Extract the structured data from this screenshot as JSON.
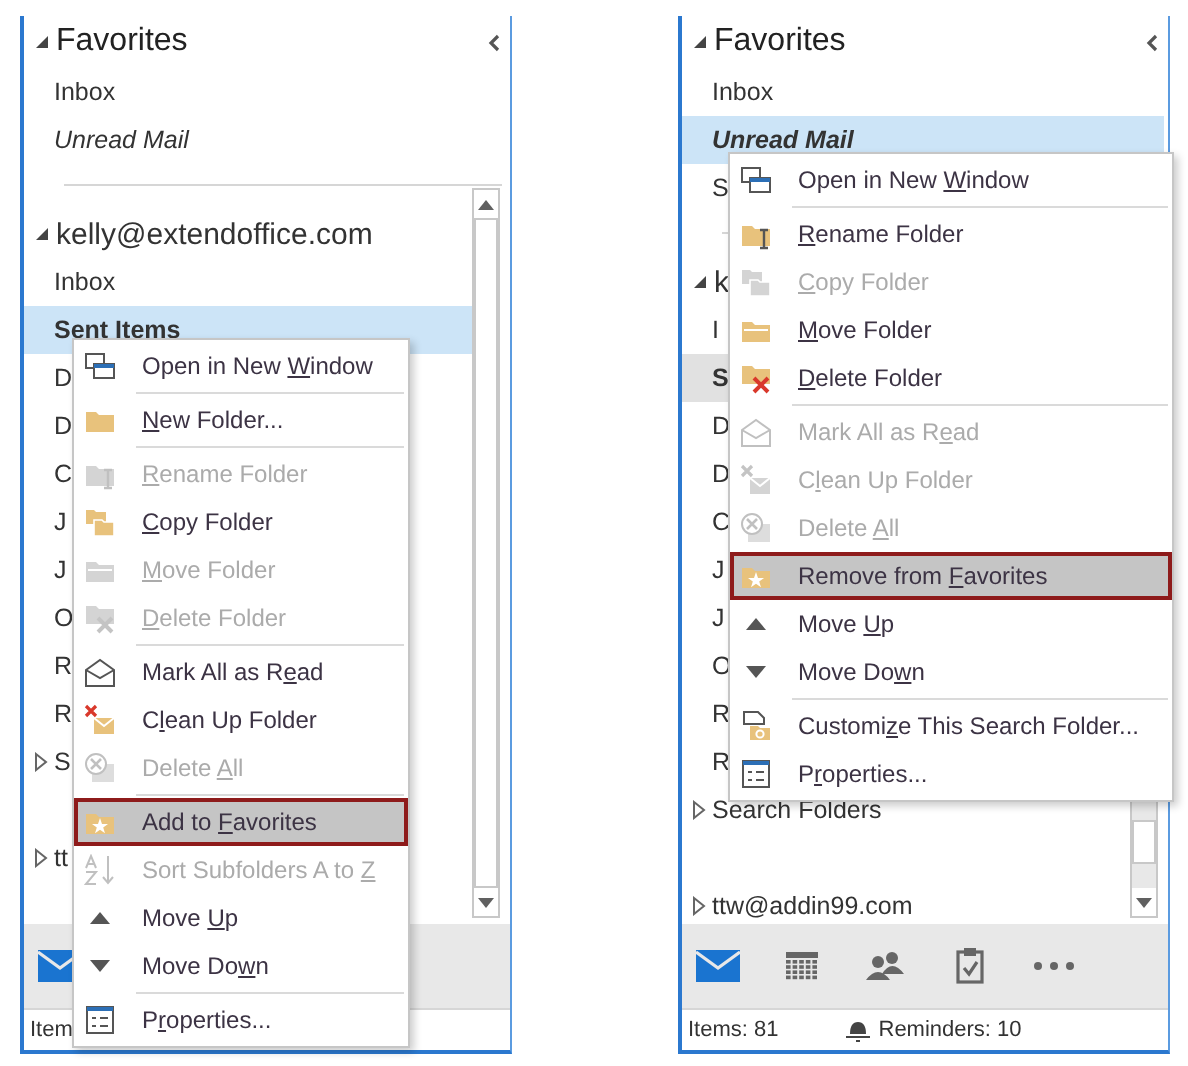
{
  "panes": [
    {
      "favorites": {
        "title": "Favorites",
        "expanded": true,
        "items": [
          {
            "label": "Inbox",
            "italic": false,
            "selected": false,
            "focused": false
          },
          {
            "label": "Unread Mail",
            "italic": true,
            "selected": false,
            "focused": false
          }
        ]
      },
      "account": {
        "title": "kelly@extendoffice.com",
        "expanded": true,
        "folders": [
          {
            "label": "Inbox",
            "selected": false,
            "focused": false
          },
          {
            "label": "Sent Items",
            "selected": true,
            "focused": true
          },
          {
            "label": "D",
            "selected": false,
            "focused": false
          },
          {
            "label": "D",
            "selected": false,
            "focused": false
          },
          {
            "label": "C",
            "selected": false,
            "focused": false
          },
          {
            "label": "J",
            "selected": false,
            "focused": false
          },
          {
            "label": "J",
            "selected": false,
            "focused": false
          },
          {
            "label": "O",
            "selected": false,
            "focused": false
          },
          {
            "label": "R",
            "selected": false,
            "focused": false
          },
          {
            "label": "R",
            "selected": false,
            "focused": false
          }
        ]
      },
      "sections": [
        {
          "label": "S",
          "expanded": false
        },
        {
          "label": "tt",
          "expanded": false
        }
      ],
      "nav": [
        {
          "kind": "mail",
          "selected": true
        }
      ],
      "status": {
        "items": "Item"
      },
      "menu": {
        "entries": [
          {
            "kind": "window",
            "label": {
              "before": "Open in New ",
              "key": "W",
              "after": "indow"
            },
            "disabled": false,
            "highlighted": false
          },
          {
            "kind": "separator"
          },
          {
            "kind": "folder",
            "label": {
              "key": "N",
              "after": "ew Folder..."
            },
            "disabled": false,
            "highlighted": false
          },
          {
            "kind": "separator"
          },
          {
            "kind": "rename",
            "label": {
              "key": "R",
              "after": "ename Folder"
            },
            "disabled": true,
            "highlighted": false
          },
          {
            "kind": "copy",
            "label": {
              "key": "C",
              "after": "opy Folder"
            },
            "disabled": false,
            "highlighted": false
          },
          {
            "kind": "move",
            "label": {
              "key": "M",
              "after": "ove Folder"
            },
            "disabled": true,
            "highlighted": false
          },
          {
            "kind": "delete",
            "label": {
              "key": "D",
              "after": "elete Folder"
            },
            "disabled": true,
            "highlighted": false
          },
          {
            "kind": "separator"
          },
          {
            "kind": "markread",
            "label": {
              "before": "Mark All as R",
              "key": "e",
              "after": "ad"
            },
            "disabled": false,
            "highlighted": false
          },
          {
            "kind": "cleanup",
            "label": {
              "before": "C",
              "key": "l",
              "after": "ean Up Folder"
            },
            "disabled": false,
            "highlighted": false
          },
          {
            "kind": "deleteall",
            "label": {
              "before": "Delete ",
              "key": "A",
              "after": "ll"
            },
            "disabled": true,
            "highlighted": false
          },
          {
            "kind": "separator"
          },
          {
            "kind": "favorite",
            "label": {
              "before": "Add to ",
              "key": "F",
              "after": "avorites"
            },
            "disabled": false,
            "highlighted": true
          },
          {
            "kind": "sort",
            "label": {
              "before": "Sort Subfolders A to ",
              "key": "Z"
            },
            "disabled": true,
            "highlighted": false
          },
          {
            "kind": "up",
            "label": {
              "before": "Move ",
              "key": "U",
              "after": "p"
            },
            "disabled": false,
            "highlighted": false
          },
          {
            "kind": "down",
            "label": {
              "before": "Move Do",
              "key": "w",
              "after": "n"
            },
            "disabled": false,
            "highlighted": false
          },
          {
            "kind": "separator"
          },
          {
            "kind": "properties",
            "label": {
              "before": "P",
              "key": "r",
              "after": "operties..."
            },
            "disabled": false,
            "highlighted": false
          }
        ]
      }
    },
    {
      "favorites": {
        "title": "Favorites",
        "expanded": true,
        "items": [
          {
            "label": "Inbox",
            "italic": false,
            "selected": false,
            "focused": false
          },
          {
            "label": "Unread Mail",
            "italic": true,
            "selected": true,
            "focused": true
          },
          {
            "label": "S",
            "italic": false,
            "selected": false,
            "focused": false
          }
        ]
      },
      "account": {
        "title": "k",
        "expanded": true,
        "folders": [
          {
            "label": "I",
            "selected": false,
            "focused": false
          },
          {
            "label": "S",
            "selected": true,
            "focused": false
          },
          {
            "label": "D",
            "selected": false,
            "focused": false
          },
          {
            "label": "D",
            "selected": false,
            "focused": false
          },
          {
            "label": "C",
            "selected": false,
            "focused": false
          },
          {
            "label": "J",
            "selected": false,
            "focused": false
          },
          {
            "label": "J",
            "selected": false,
            "focused": false
          },
          {
            "label": "O",
            "selected": false,
            "focused": false
          },
          {
            "label": "R",
            "selected": false,
            "focused": false
          },
          {
            "label": "R",
            "selected": false,
            "focused": false
          }
        ]
      },
      "sections": [
        {
          "label": "Search Folders",
          "expanded": false
        },
        {
          "label": "ttw@addin99.com",
          "expanded": false
        }
      ],
      "nav": [
        {
          "kind": "mail",
          "selected": true
        },
        {
          "kind": "calendar",
          "selected": false
        },
        {
          "kind": "people",
          "selected": false
        },
        {
          "kind": "tasks",
          "selected": false
        },
        {
          "kind": "more",
          "selected": false
        }
      ],
      "status": {
        "items": "Items: 81",
        "reminders": "Reminders: 10"
      },
      "menu": {
        "entries": [
          {
            "kind": "window",
            "label": {
              "before": "Open in New ",
              "key": "W",
              "after": "indow"
            },
            "disabled": false,
            "highlighted": false
          },
          {
            "kind": "separator"
          },
          {
            "kind": "rename",
            "label": {
              "key": "R",
              "after": "ename Folder"
            },
            "disabled": false,
            "highlighted": false
          },
          {
            "kind": "copy",
            "label": {
              "key": "C",
              "after": "opy Folder"
            },
            "disabled": true,
            "highlighted": false
          },
          {
            "kind": "move",
            "label": {
              "key": "M",
              "after": "ove Folder"
            },
            "disabled": false,
            "highlighted": false
          },
          {
            "kind": "delete",
            "label": {
              "key": "D",
              "after": "elete Folder"
            },
            "disabled": false,
            "highlighted": false
          },
          {
            "kind": "separator"
          },
          {
            "kind": "markread",
            "label": {
              "before": "Mark All as R",
              "key": "e",
              "after": "ad"
            },
            "disabled": true,
            "highlighted": false
          },
          {
            "kind": "cleanup",
            "label": {
              "before": "C",
              "key": "l",
              "after": "ean Up Folder"
            },
            "disabled": true,
            "highlighted": false
          },
          {
            "kind": "deleteall",
            "label": {
              "before": "Delete ",
              "key": "A",
              "after": "ll"
            },
            "disabled": true,
            "highlighted": false
          },
          {
            "kind": "favorite",
            "label": {
              "before": "Remove from ",
              "key": "F",
              "after": "avorites"
            },
            "disabled": false,
            "highlighted": true
          },
          {
            "kind": "up",
            "label": {
              "before": "Move ",
              "key": "U",
              "after": "p"
            },
            "disabled": false,
            "highlighted": false
          },
          {
            "kind": "down",
            "label": {
              "before": "Move Do",
              "key": "w",
              "after": "n"
            },
            "disabled": false,
            "highlighted": false
          },
          {
            "kind": "separator"
          },
          {
            "kind": "search",
            "label": {
              "before": "Customi",
              "key": "z",
              "after": "e This Search Folder..."
            },
            "disabled": false,
            "highlighted": false
          },
          {
            "kind": "properties",
            "label": {
              "before": "P",
              "key": "r",
              "after": "operties..."
            },
            "disabled": false,
            "highlighted": false
          }
        ]
      }
    }
  ]
}
